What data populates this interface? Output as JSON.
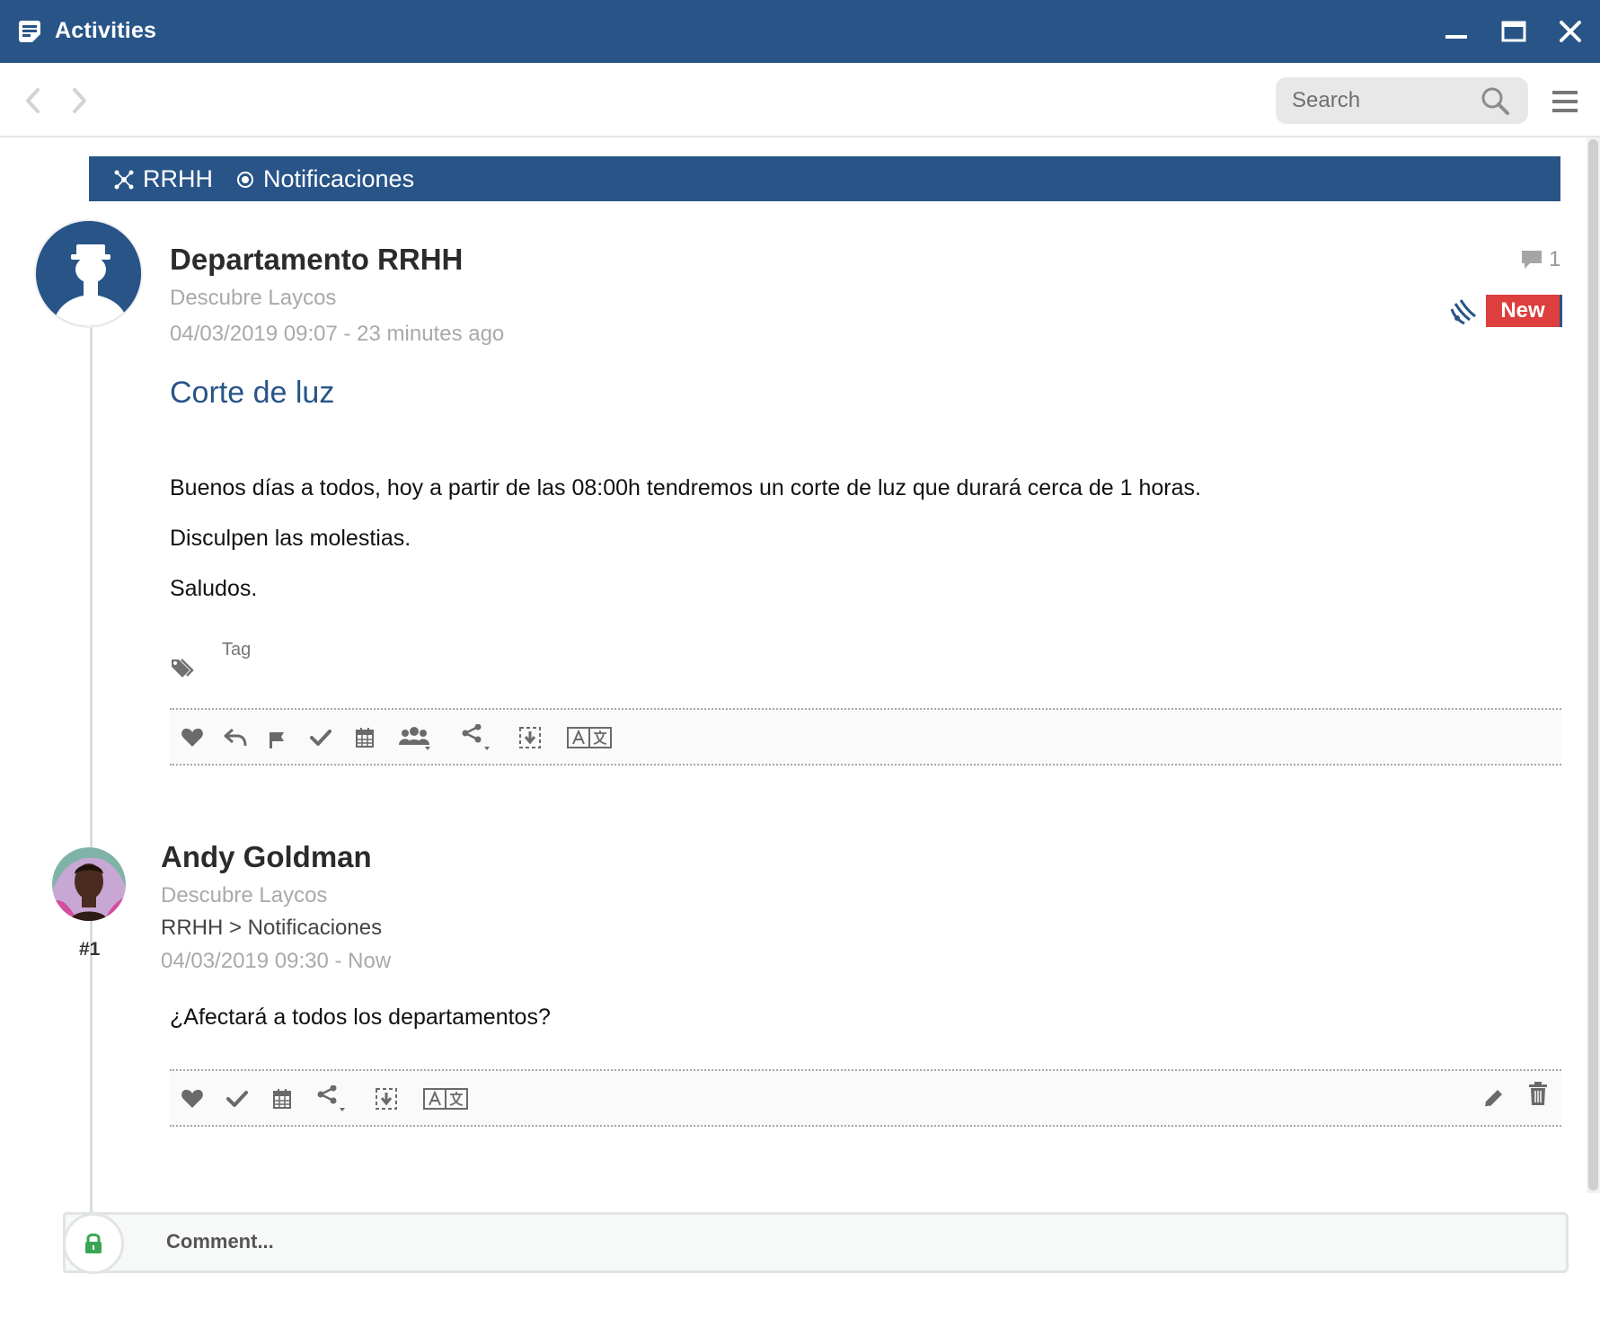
{
  "window": {
    "title": "Activities",
    "icons": {
      "app": "notes-icon",
      "minimize": "minimize-icon",
      "maximize": "maximize-icon",
      "close": "close-icon"
    }
  },
  "toolbar": {
    "search_placeholder": "Search",
    "icons": {
      "back": "chevron-left-icon",
      "forward": "chevron-right-icon",
      "search": "search-icon",
      "menu": "hamburger-menu-icon"
    }
  },
  "breadcrumb_band": {
    "items": [
      {
        "label": "RRHH",
        "icon": "network-icon"
      },
      {
        "label": "Notificaciones",
        "icon": "radio-dot-icon"
      }
    ]
  },
  "post": {
    "author": "Departamento RRHH",
    "subtitle": "Descubre Laycos",
    "date": "04/03/2019 09:07 - 23 minutes ago",
    "comment_count": "1",
    "status_badge": "New",
    "title": "Corte de luz",
    "body": [
      "Buenos días a todos, hoy a partir de las 08:00h tendremos un corte de luz que durará cerca de 1 horas.",
      "Disculpen las molestias.",
      "Saludos."
    ],
    "tag_label": "Tag",
    "actions": [
      "heart-icon",
      "reply-icon",
      "flag-icon",
      "check-icon",
      "calendar-icon",
      "group-icon",
      "share-icon",
      "download-icon",
      "translate-icon"
    ]
  },
  "reply": {
    "number": "#1",
    "author": "Andy Goldman",
    "subtitle": "Descubre Laycos",
    "path": "RRHH > Notificaciones",
    "date": "04/03/2019 09:30 - Now",
    "body": "¿Afectará a todos los departamentos?",
    "actions": [
      "heart-icon",
      "check-icon",
      "calendar-icon",
      "share-icon",
      "download-icon",
      "translate-icon",
      "edit-icon",
      "trash-icon"
    ]
  },
  "comment_box": {
    "placeholder": "Comment..."
  },
  "colors": {
    "brand": "#285487",
    "badge_new": "#dd3e3e",
    "muted_text": "#a9a9a9",
    "lock_green": "#3aa655"
  }
}
